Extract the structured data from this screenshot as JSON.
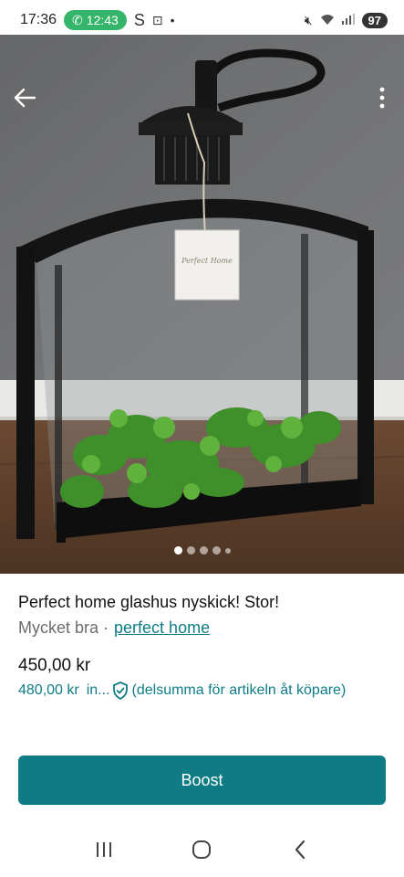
{
  "status_bar": {
    "time": "17:36",
    "call_timer": "12:43",
    "left_icons": [
      "phone-icon",
      "s-icon",
      "screenshot-icon",
      "dot-icon"
    ],
    "right_icons": [
      "mute-icon",
      "wifi-icon",
      "signal-icon"
    ],
    "battery": "97"
  },
  "hero": {
    "back_icon": "back-arrow-icon",
    "more_icon": "more-vertical-icon",
    "pages_total": 5,
    "page_current": 1,
    "tag_text": "Perfect Home"
  },
  "listing": {
    "title": "Perfect home glashus nyskick! Stor!",
    "condition": "Mycket bra ·",
    "brand": "perfect home",
    "price": "450,00 kr",
    "buyer_price": "480,00 kr",
    "buyer_short": "in...",
    "buyer_note": "(delsumma för artikeln åt köpare)"
  },
  "actions": {
    "boost_label": "Boost"
  },
  "nav": {
    "recents_icon": "recents-icon",
    "home_icon": "home-icon",
    "back_icon": "nav-back-icon"
  },
  "colors": {
    "accent": "#0f7c85",
    "call_pill": "#34b56a"
  }
}
